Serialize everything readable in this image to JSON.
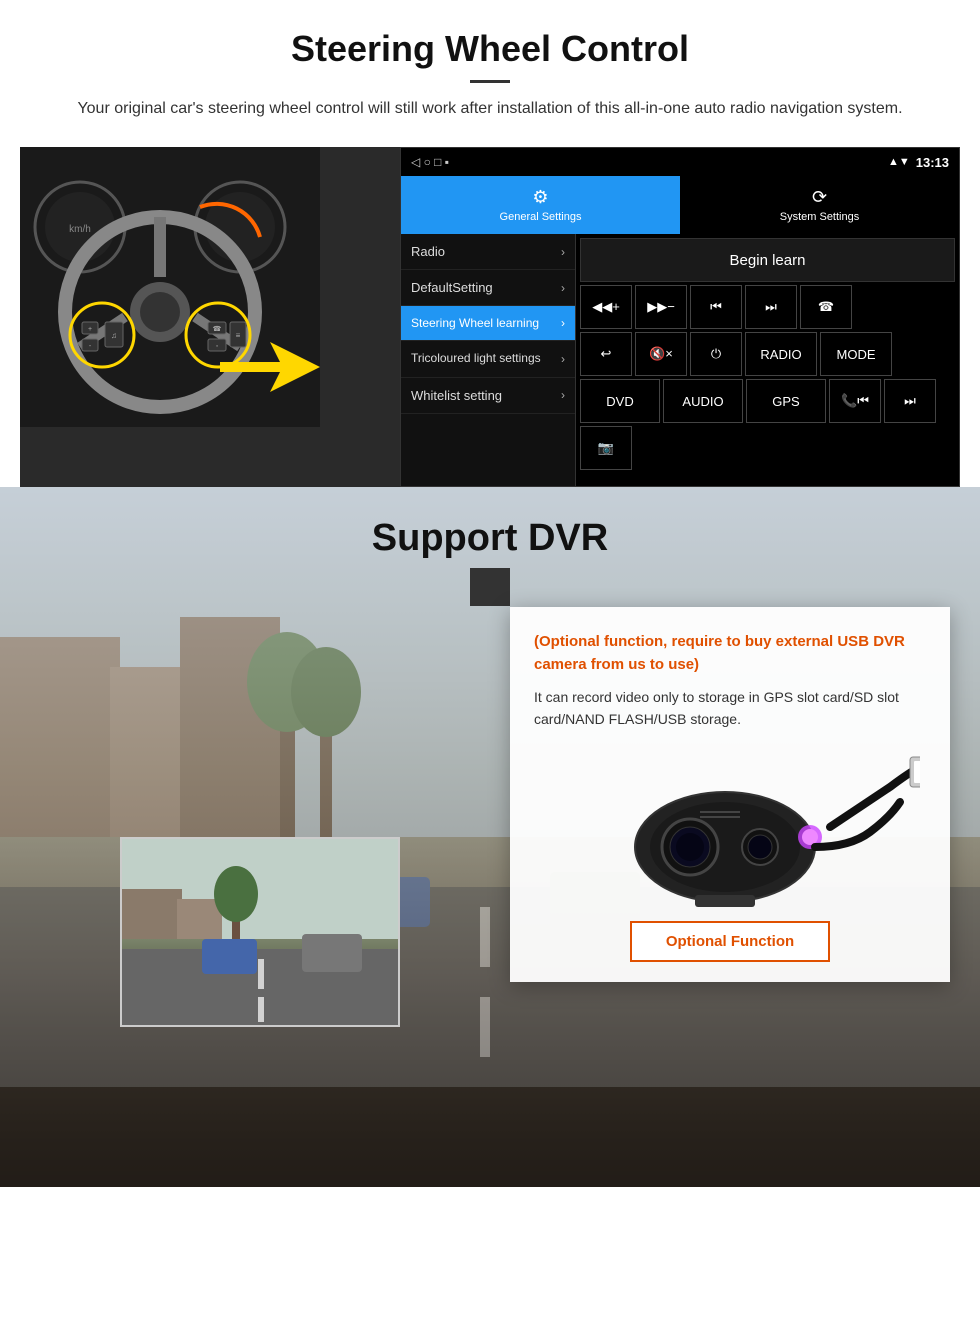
{
  "steering_section": {
    "title": "Steering Wheel Control",
    "description": "Your original car's steering wheel control will still work after installation of this all-in-one auto radio navigation system.",
    "statusbar": {
      "time": "13:13",
      "icons": [
        "signal",
        "wifi",
        "battery"
      ]
    },
    "tabs": [
      {
        "id": "general",
        "label": "General Settings",
        "active": true,
        "icon": "⚙"
      },
      {
        "id": "system",
        "label": "System Settings",
        "active": false,
        "icon": "🔄"
      }
    ],
    "menu_items": [
      {
        "label": "Radio",
        "active": false
      },
      {
        "label": "DefaultSetting",
        "active": false
      },
      {
        "label": "Steering Wheel learning",
        "active": true
      },
      {
        "label": "Tricoloured light settings",
        "active": false
      },
      {
        "label": "Whitelist setting",
        "active": false
      }
    ],
    "begin_learn_label": "Begin learn",
    "control_buttons": [
      [
        "vol+",
        "vol-",
        "⏮",
        "⏭",
        "☎"
      ],
      [
        "↩",
        "🔇×",
        "⏻",
        "RADIO",
        "MODE"
      ],
      [
        "DVD",
        "AUDIO",
        "GPS",
        "📞⏮",
        "⏭"
      ]
    ]
  },
  "dvr_section": {
    "title": "Support DVR",
    "optional_note": "(Optional function, require to buy external USB DVR camera from us to use)",
    "description": "It can record video only to storage in GPS slot card/SD slot card/NAND FLASH/USB storage.",
    "optional_function_label": "Optional Function"
  }
}
